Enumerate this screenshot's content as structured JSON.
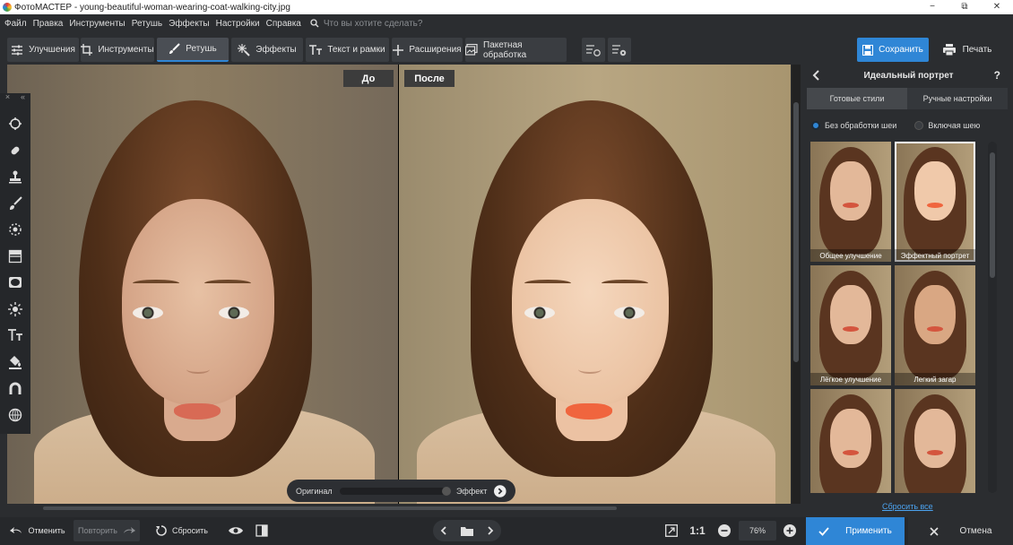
{
  "window": {
    "title": "ФотоМАСТЕР - young-beautiful-woman-wearing-coat-walking-city.jpg",
    "minimize": "−",
    "restore": "⧉",
    "close": "✕"
  },
  "menu": {
    "items": [
      "Файл",
      "Правка",
      "Инструменты",
      "Ретушь",
      "Эффекты",
      "Настройки",
      "Справка"
    ],
    "search_placeholder": "Что вы хотите сделать?"
  },
  "toolbar": {
    "tabs": [
      {
        "label": "Улучшения",
        "icon": "sliders-icon"
      },
      {
        "label": "Инструменты",
        "icon": "crop-icon"
      },
      {
        "label": "Ретушь",
        "icon": "brush-icon",
        "active": true
      },
      {
        "label": "Эффекты",
        "icon": "sparkle-icon"
      },
      {
        "label": "Текст и рамки",
        "icon": "text-icon"
      },
      {
        "label": "Расширения",
        "icon": "plus-icon"
      },
      {
        "label": "Пакетная обработка",
        "icon": "batch-icon"
      }
    ],
    "save_label": "Сохранить",
    "print_label": "Печать"
  },
  "left_tools": {
    "collapse": "«",
    "close": "×",
    "icons": [
      "heal-icon",
      "patch-icon",
      "stamp-icon",
      "brush-icon",
      "radial-icon",
      "gradient-icon",
      "vignette-icon",
      "light-icon",
      "text-icon",
      "fill-icon",
      "magnet-icon",
      "globe-icon"
    ]
  },
  "compare": {
    "before_label": "До",
    "after_label": "После",
    "slider_left": "Оригинал",
    "slider_right": "Эффект",
    "effect_level": 0.98
  },
  "right_panel": {
    "title": "Идеальный портрет",
    "help": "?",
    "tabs": [
      "Готовые стили",
      "Ручные настройки"
    ],
    "radio_options": [
      {
        "label": "Без обработки шеи",
        "selected": true
      },
      {
        "label": "Включая шею",
        "selected": false
      }
    ],
    "styles": [
      {
        "label": "Общее улучшение",
        "selected": false
      },
      {
        "label": "Эффектный портрет",
        "selected": true
      },
      {
        "label": "Лёгкое улучшение",
        "selected": false
      },
      {
        "label": "Легкий загар",
        "selected": false
      },
      {
        "label": "",
        "selected": false
      },
      {
        "label": "",
        "selected": false
      }
    ],
    "reset_all": "Сбросить все"
  },
  "bottom": {
    "undo": "Отменить",
    "redo": "Повторить",
    "reset": "Сбросить",
    "ratio": "1:1",
    "zoom": "76%",
    "apply": "Применить",
    "cancel": "Отмена"
  },
  "colors": {
    "accent": "#2f86d6",
    "background": "#2b2d30",
    "link": "#4ba3f0"
  }
}
